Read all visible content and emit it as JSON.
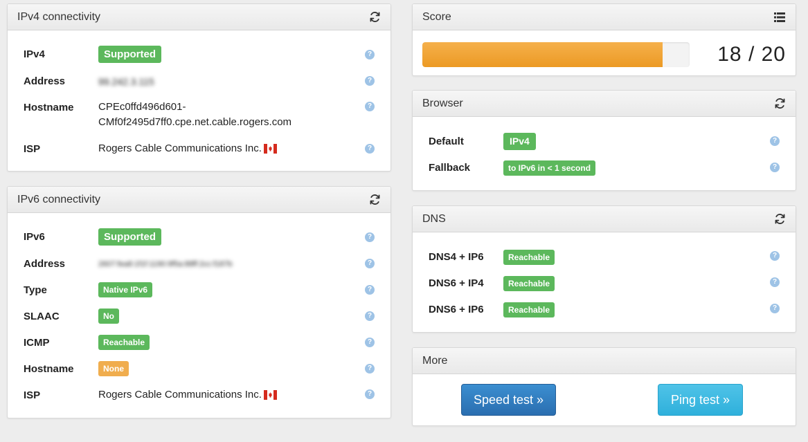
{
  "ipv4": {
    "title": "IPv4 connectivity",
    "rows": [
      {
        "label": "IPv4",
        "value": "Supported"
      },
      {
        "label": "Address",
        "value": "99.242.3.115"
      },
      {
        "label": "Hostname",
        "value_line1": "CPEc0ffd496d601-",
        "value_line2": "CMf0f2495d7ff0.cpe.net.cable.rogers.com"
      },
      {
        "label": "ISP",
        "value": "Rogers Cable Communications Inc."
      }
    ]
  },
  "ipv6": {
    "title": "IPv6 connectivity",
    "rows": [
      {
        "label": "IPv6",
        "value": "Supported"
      },
      {
        "label": "Address",
        "value": "2607:fea8:1f1f:1190:9f5a:88ff:2cc:f187b"
      },
      {
        "label": "Type",
        "value": "Native IPv6"
      },
      {
        "label": "SLAAC",
        "value": "No"
      },
      {
        "label": "ICMP",
        "value": "Reachable"
      },
      {
        "label": "Hostname",
        "value": "None"
      },
      {
        "label": "ISP",
        "value": "Rogers Cable Communications Inc."
      }
    ]
  },
  "score": {
    "title": "Score",
    "text": "18 / 20",
    "progress_fraction": 0.9
  },
  "browser": {
    "title": "Browser",
    "rows": [
      {
        "label": "Default",
        "value": "IPv4"
      },
      {
        "label": "Fallback",
        "value": "to IPv6 in < 1 second"
      }
    ]
  },
  "dns": {
    "title": "DNS",
    "rows": [
      {
        "label": "DNS4 + IP6",
        "value": "Reachable"
      },
      {
        "label": "DNS6 + IP4",
        "value": "Reachable"
      },
      {
        "label": "DNS6 + IP6",
        "value": "Reachable"
      }
    ]
  },
  "more": {
    "title": "More",
    "speed_test": "Speed test »",
    "ping_test": "Ping test »"
  },
  "help_glyph": "?",
  "icons": {
    "refresh": "refresh-icon",
    "list": "list-icon",
    "help": "help-icon",
    "flag": "canada-flag-icon"
  },
  "colors": {
    "success": "#5cb85c",
    "warning": "#f0ad4e",
    "progress": "#ec9a24",
    "primary": "#2a6eb0",
    "info": "#2fb0db",
    "help": "#9ec3e6"
  }
}
